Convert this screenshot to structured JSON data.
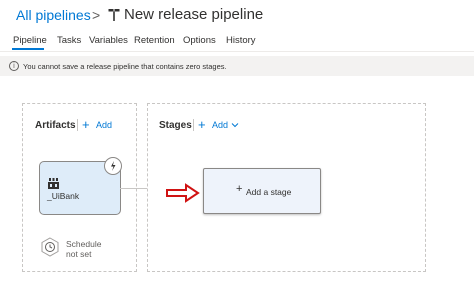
{
  "header": {
    "breadcrumb_link": "All pipelines",
    "separator": ">",
    "title": "New release pipeline"
  },
  "tabs": [
    {
      "label": "Pipeline",
      "active": true
    },
    {
      "label": "Tasks"
    },
    {
      "label": "Variables"
    },
    {
      "label": "Retention"
    },
    {
      "label": "Options"
    },
    {
      "label": "History"
    }
  ],
  "infobar": {
    "icon": "i",
    "message": "You cannot save a release pipeline that contains zero stages."
  },
  "artifacts": {
    "title": "Artifacts",
    "add_label": "Add",
    "card": {
      "name": "_UiBank",
      "icon": "build-artifact-icon"
    },
    "schedule": {
      "line1": "Schedule",
      "line2": "not set"
    }
  },
  "stages": {
    "title": "Stages",
    "add_label": "Add",
    "add_stage_label": "Add a stage"
  },
  "colors": {
    "accent": "#0078d4",
    "card_bg": "#deecf9",
    "annotation_arrow": "#d01313"
  }
}
